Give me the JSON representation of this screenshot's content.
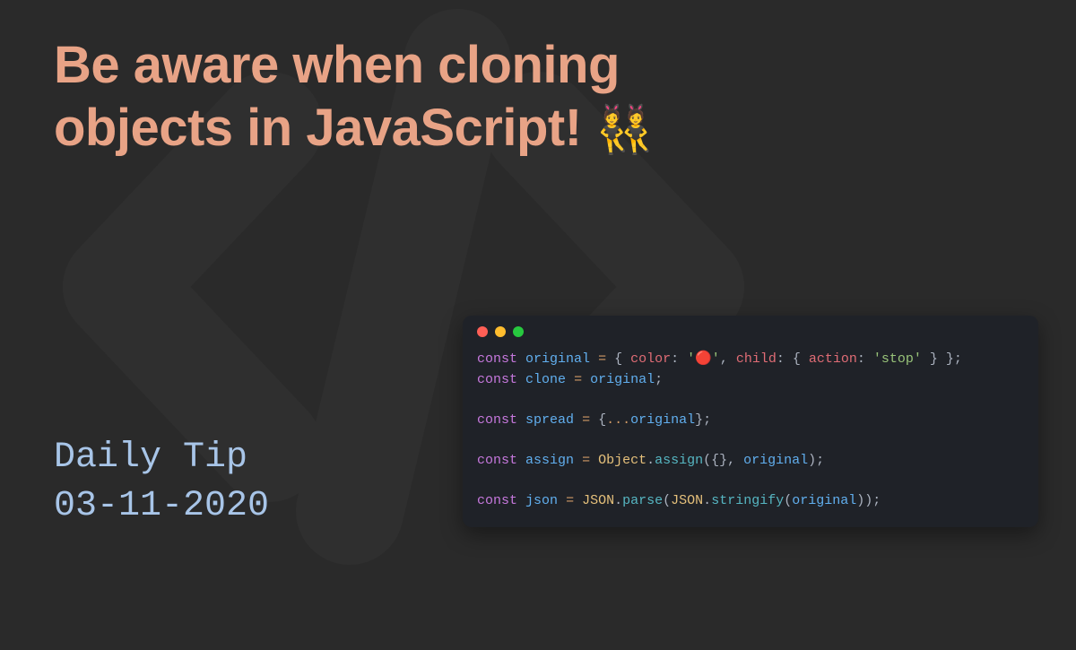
{
  "title_line1": "Be aware when cloning",
  "title_line2": "objects in JavaScript! ",
  "title_emoji": "👯",
  "series": {
    "label": "Daily Tip",
    "date": "03-11-2020"
  },
  "code": {
    "lines": [
      [
        {
          "c": "kw",
          "t": "const"
        },
        {
          "c": "punc",
          "t": " "
        },
        {
          "c": "var",
          "t": "original"
        },
        {
          "c": "punc",
          "t": " "
        },
        {
          "c": "op",
          "t": "="
        },
        {
          "c": "punc",
          "t": " { "
        },
        {
          "c": "prop",
          "t": "color"
        },
        {
          "c": "punc",
          "t": ": "
        },
        {
          "c": "str",
          "t": "'🔴'"
        },
        {
          "c": "punc",
          "t": ", "
        },
        {
          "c": "prop",
          "t": "child"
        },
        {
          "c": "punc",
          "t": ": { "
        },
        {
          "c": "prop",
          "t": "action"
        },
        {
          "c": "punc",
          "t": ": "
        },
        {
          "c": "str",
          "t": "'stop'"
        },
        {
          "c": "punc",
          "t": " } };"
        }
      ],
      [
        {
          "c": "kw",
          "t": "const"
        },
        {
          "c": "punc",
          "t": " "
        },
        {
          "c": "var",
          "t": "clone"
        },
        {
          "c": "punc",
          "t": " "
        },
        {
          "c": "op",
          "t": "="
        },
        {
          "c": "punc",
          "t": " "
        },
        {
          "c": "var",
          "t": "original"
        },
        {
          "c": "punc",
          "t": ";"
        }
      ],
      [],
      [
        {
          "c": "kw",
          "t": "const"
        },
        {
          "c": "punc",
          "t": " "
        },
        {
          "c": "var",
          "t": "spread"
        },
        {
          "c": "punc",
          "t": " "
        },
        {
          "c": "op",
          "t": "="
        },
        {
          "c": "punc",
          "t": " {"
        },
        {
          "c": "op",
          "t": "..."
        },
        {
          "c": "var",
          "t": "original"
        },
        {
          "c": "punc",
          "t": "};"
        }
      ],
      [],
      [
        {
          "c": "kw",
          "t": "const"
        },
        {
          "c": "punc",
          "t": " "
        },
        {
          "c": "var",
          "t": "assign"
        },
        {
          "c": "punc",
          "t": " "
        },
        {
          "c": "op",
          "t": "="
        },
        {
          "c": "punc",
          "t": " "
        },
        {
          "c": "cls",
          "t": "Object"
        },
        {
          "c": "punc",
          "t": "."
        },
        {
          "c": "mtd",
          "t": "assign"
        },
        {
          "c": "punc",
          "t": "({}, "
        },
        {
          "c": "var",
          "t": "original"
        },
        {
          "c": "punc",
          "t": ");"
        }
      ],
      [],
      [
        {
          "c": "kw",
          "t": "const"
        },
        {
          "c": "punc",
          "t": " "
        },
        {
          "c": "var",
          "t": "json"
        },
        {
          "c": "punc",
          "t": " "
        },
        {
          "c": "op",
          "t": "="
        },
        {
          "c": "punc",
          "t": " "
        },
        {
          "c": "cls",
          "t": "JSON"
        },
        {
          "c": "punc",
          "t": "."
        },
        {
          "c": "mtd",
          "t": "parse"
        },
        {
          "c": "punc",
          "t": "("
        },
        {
          "c": "cls",
          "t": "JSON"
        },
        {
          "c": "punc",
          "t": "."
        },
        {
          "c": "mtd",
          "t": "stringify"
        },
        {
          "c": "punc",
          "t": "("
        },
        {
          "c": "var",
          "t": "original"
        },
        {
          "c": "punc",
          "t": "));"
        }
      ]
    ]
  }
}
